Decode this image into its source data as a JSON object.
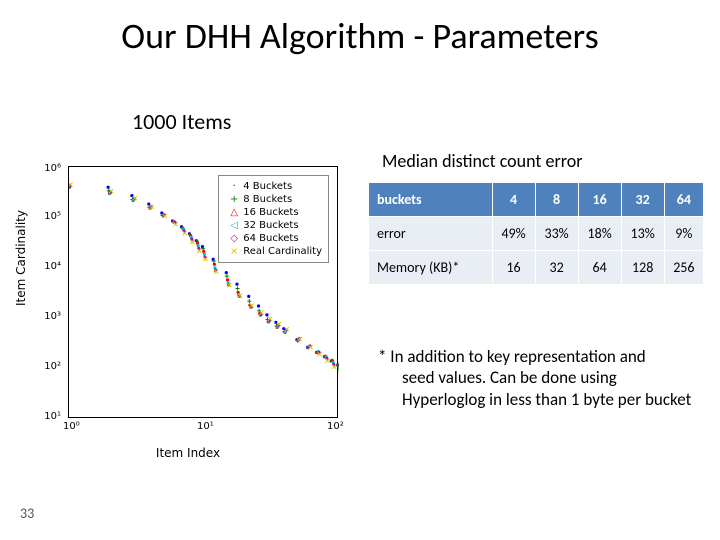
{
  "title": "Our DHH Algorithm - Parameters",
  "subtitle": "1000 Items",
  "slide_number": "33",
  "chart": {
    "xlabel": "Item Index",
    "ylabel": "Item Cardinality",
    "xticks": [
      "10⁰",
      "10¹",
      "10²"
    ],
    "yticks": [
      "10¹",
      "10²",
      "10³",
      "10⁴",
      "10⁵",
      "10⁶"
    ],
    "legend": [
      {
        "marker": "·",
        "color": "#0000ff",
        "label": "4 Buckets"
      },
      {
        "marker": "+",
        "color": "#008000",
        "label": "8 Buckets"
      },
      {
        "marker": "△",
        "color": "#ff0000",
        "label": "16 Buckets"
      },
      {
        "marker": "◁",
        "color": "#00bfbf",
        "label": "32 Buckets"
      },
      {
        "marker": "◇",
        "color": "#bf00bf",
        "label": "64 Buckets"
      },
      {
        "marker": "×",
        "color": "#d4c400",
        "label": "Real Cardinality"
      }
    ]
  },
  "table": {
    "title": "Median distinct count error",
    "header": [
      "buckets",
      "4",
      "8",
      "16",
      "32",
      "64"
    ],
    "rows": [
      {
        "label": "error",
        "cells": [
          "49%",
          "33%",
          "18%",
          "13%",
          "9%"
        ]
      },
      {
        "label": "Memory (KB)*",
        "cells": [
          "16",
          "32",
          "64",
          "128",
          "256"
        ]
      }
    ]
  },
  "footnote": {
    "lead": "* In addition to key representation and",
    "rest": "seed values.  Can be done using Hyperloglog  in less than 1 byte per bucket"
  },
  "chart_data": {
    "type": "scatter",
    "title": "",
    "xlabel": "Item Index",
    "ylabel": "Item Cardinality",
    "x_scale": "log",
    "y_scale": "log",
    "xlim": [
      1,
      100
    ],
    "ylim": [
      10,
      1000000
    ],
    "x": [
      1,
      2,
      3,
      4,
      5,
      6,
      7,
      8,
      9,
      10,
      12,
      15,
      18,
      22,
      26,
      30,
      35,
      40,
      50,
      60,
      70,
      80,
      90,
      100
    ],
    "series": [
      {
        "name": "4 Buckets",
        "values": [
          550000,
          420000,
          300000,
          210000,
          140000,
          95000,
          70000,
          48000,
          33000,
          24000,
          13000,
          7000,
          4200,
          2500,
          1700,
          1200,
          900,
          700,
          430,
          300,
          230,
          180,
          140,
          110
        ]
      },
      {
        "name": "8 Buckets",
        "values": [
          500000,
          380000,
          260000,
          180000,
          120000,
          85000,
          60000,
          42000,
          30000,
          21000,
          12000,
          6200,
          3700,
          2200,
          1500,
          1050,
          800,
          620,
          400,
          280,
          210,
          165,
          130,
          105
        ]
      },
      {
        "name": "16 Buckets",
        "values": [
          460000,
          340000,
          240000,
          160000,
          110000,
          78000,
          55000,
          38000,
          27000,
          19000,
          11000,
          5700,
          3400,
          2000,
          1400,
          970,
          740,
          570,
          370,
          260,
          195,
          155,
          125,
          100
        ]
      },
      {
        "name": "32 Buckets",
        "values": [
          440000,
          320000,
          225000,
          150000,
          100000,
          72000,
          51000,
          36000,
          25500,
          18000,
          10200,
          5400,
          3200,
          1900,
          1300,
          920,
          700,
          540,
          350,
          250,
          190,
          150,
          120,
          98
        ]
      },
      {
        "name": "64 Buckets",
        "values": [
          430000,
          310000,
          218000,
          145000,
          98000,
          70000,
          49000,
          35000,
          24500,
          17300,
          9900,
          5200,
          3100,
          1850,
          1260,
          900,
          685,
          530,
          345,
          245,
          186,
          148,
          118,
          96
        ]
      },
      {
        "name": "Real Cardinality",
        "values": [
          420000,
          300000,
          210000,
          140000,
          95000,
          68000,
          48000,
          34000,
          24000,
          17000,
          9700,
          5100,
          3050,
          1820,
          1240,
          890,
          680,
          525,
          342,
          243,
          185,
          147,
          117,
          95
        ]
      }
    ],
    "legend_position": "upper right"
  }
}
